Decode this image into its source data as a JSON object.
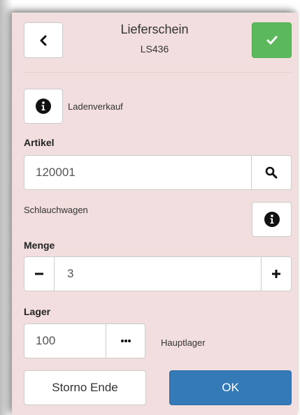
{
  "header": {
    "title": "Lieferschein",
    "subtitle": "LS436"
  },
  "customer": {
    "name": "Ladenverkauf"
  },
  "article": {
    "label": "Artikel",
    "value": "120001",
    "description": "Schlauchwagen"
  },
  "quantity": {
    "label": "Menge",
    "value": "3"
  },
  "storage": {
    "label": "Lager",
    "value": "100",
    "name": "Hauptlager"
  },
  "footer": {
    "cancel_label": "Storno Ende",
    "ok_label": "OK"
  },
  "colors": {
    "panel_background": "#f2dede",
    "success": "#5cb85c",
    "primary": "#337ab7"
  },
  "icons": {
    "back": "chevron-left-icon",
    "confirm": "check-icon",
    "info": "info-circle-icon",
    "search": "search-icon",
    "minus": "minus-icon",
    "plus": "plus-icon",
    "more": "ellipsis-icon"
  }
}
